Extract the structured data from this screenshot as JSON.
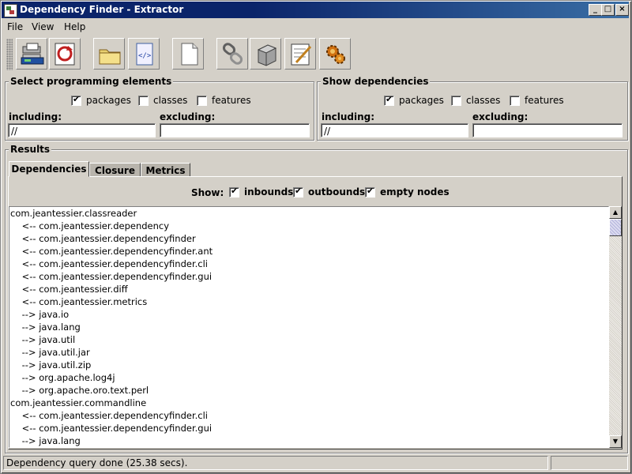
{
  "window": {
    "title": "Dependency Finder - Extractor"
  },
  "title_buttons": {
    "minimize": "_",
    "maximize": "□",
    "close": "×"
  },
  "menu": [
    "File",
    "View",
    "Help"
  ],
  "toolbar": [
    {
      "name": "extract-icon"
    },
    {
      "name": "refresh-icon"
    },
    {
      "name": "open-folder-icon"
    },
    {
      "name": "xml-file-icon"
    },
    {
      "name": "new-document-icon"
    },
    {
      "name": "dependency-query-icon"
    },
    {
      "name": "closure-icon"
    },
    {
      "name": "metrics-icon"
    },
    {
      "name": "settings-gears-icon"
    }
  ],
  "select_panel": {
    "title": "Select programming elements",
    "checkboxes": [
      {
        "label": "packages",
        "checked": true
      },
      {
        "label": "classes",
        "checked": false
      },
      {
        "label": "features",
        "checked": false
      }
    ],
    "including_label": "including:",
    "including_value": "//",
    "excluding_label": "excluding:",
    "excluding_value": ""
  },
  "show_panel": {
    "title": "Show dependencies",
    "checkboxes": [
      {
        "label": "packages",
        "checked": true
      },
      {
        "label": "classes",
        "checked": false
      },
      {
        "label": "features",
        "checked": false
      }
    ],
    "including_label": "including:",
    "including_value": "//",
    "excluding_label": "excluding:",
    "excluding_value": ""
  },
  "results": {
    "title": "Results",
    "tabs": [
      "Dependencies",
      "Closure",
      "Metrics"
    ],
    "active_tab": "Dependencies",
    "show_label": "Show:",
    "show_options": [
      {
        "label": "inbounds",
        "checked": true
      },
      {
        "label": "outbounds",
        "checked": true
      },
      {
        "label": "empty nodes",
        "checked": true
      }
    ],
    "lines": [
      "com.jeantessier.classreader",
      "    <-- com.jeantessier.dependency",
      "    <-- com.jeantessier.dependencyfinder",
      "    <-- com.jeantessier.dependencyfinder.ant",
      "    <-- com.jeantessier.dependencyfinder.cli",
      "    <-- com.jeantessier.dependencyfinder.gui",
      "    <-- com.jeantessier.diff",
      "    <-- com.jeantessier.metrics",
      "    --> java.io",
      "    --> java.lang",
      "    --> java.util",
      "    --> java.util.jar",
      "    --> java.util.zip",
      "    --> org.apache.log4j",
      "    --> org.apache.oro.text.perl",
      "com.jeantessier.commandline",
      "    <-- com.jeantessier.dependencyfinder.cli",
      "    <-- com.jeantessier.dependencyfinder.gui",
      "    --> java.lang"
    ]
  },
  "status": {
    "text": "Dependency query done (25.38 secs)."
  },
  "colors": {
    "titlebar": "#0a246a",
    "face": "#d4d0c8"
  }
}
